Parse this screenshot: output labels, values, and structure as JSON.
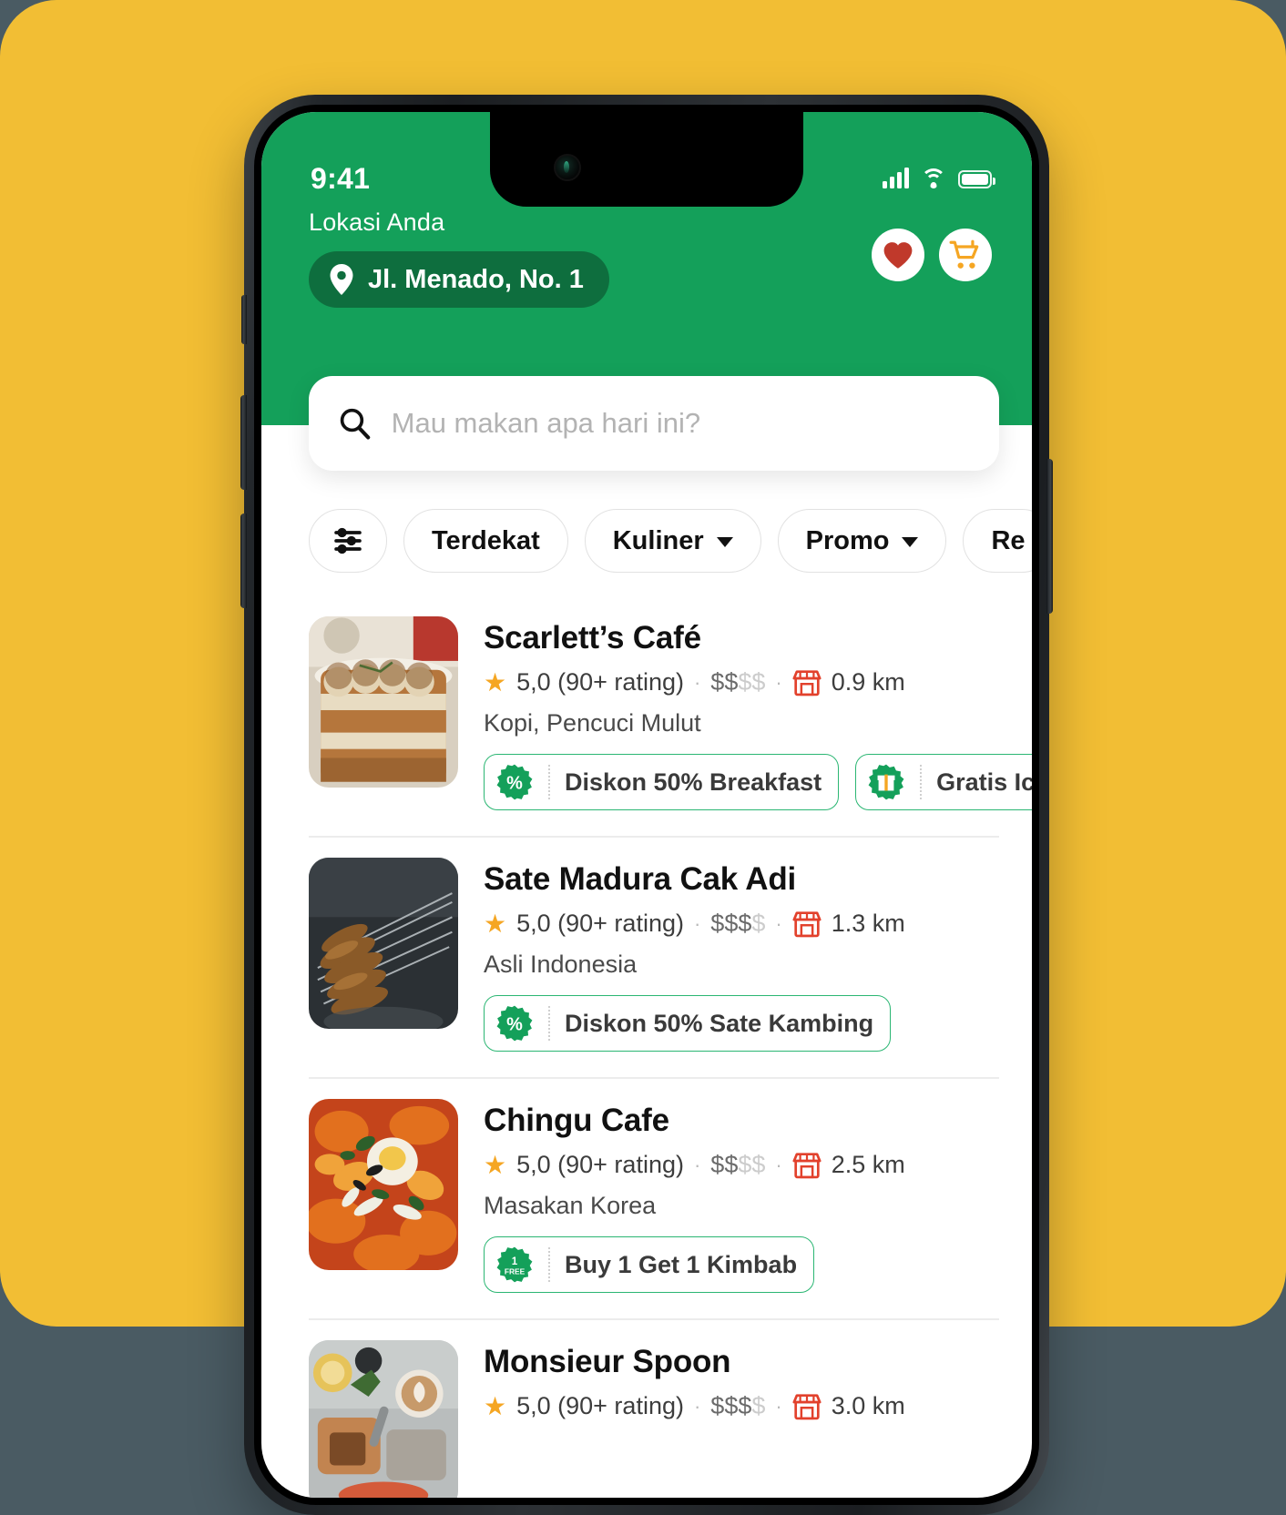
{
  "theme": {
    "backdrop_yellow": "#F2BE34",
    "brand_green": "#14A05A",
    "pill_green": "#0E6E3E",
    "promo_green": "#2BB673",
    "star_orange": "#F5A623",
    "store_red": "#E2412C",
    "heart_red": "#C0392B",
    "cart_orange": "#F5A623"
  },
  "status_bar": {
    "time": "9:41",
    "signal": "cellular-bars-icon",
    "wifi": "wifi-icon",
    "battery": "battery-icon"
  },
  "header": {
    "location_label": "Lokasi Anda",
    "location_value": "Jl. Menado, No. 1",
    "pin_icon": "location-pin-icon",
    "favorites_icon": "heart-icon",
    "cart_icon": "shopping-cart-icon"
  },
  "search": {
    "placeholder": "Mau makan apa hari ini?",
    "value": "",
    "icon": "search-icon"
  },
  "filters": [
    {
      "label": "",
      "icon": "sliders-filter-icon",
      "icon_only": true,
      "chevron": false
    },
    {
      "label": "Terdekat",
      "icon": "",
      "icon_only": false,
      "chevron": false
    },
    {
      "label": "Kuliner",
      "icon": "",
      "icon_only": false,
      "chevron": true
    },
    {
      "label": "Promo",
      "icon": "",
      "icon_only": false,
      "chevron": true
    },
    {
      "label": "Re",
      "icon": "",
      "icon_only": false,
      "chevron": false
    }
  ],
  "restaurants": [
    {
      "name": "Scarlett’s  Café",
      "rating": "5,0 (90+ rating)",
      "price_on": "$$",
      "price_off": "$$",
      "distance": "0.9 km",
      "category": "Kopi, Pencuci Mulut",
      "thumb": "tiramisu-photo",
      "promos": [
        {
          "label": "Diskon 50% Breakfast",
          "icon": "percent-badge-icon"
        },
        {
          "label": "Gratis Ice Cream",
          "icon": "gift-badge-icon"
        }
      ]
    },
    {
      "name": "Sate Madura Cak Adi",
      "rating": "5,0 (90+ rating)",
      "price_on": "$$$",
      "price_off": "$",
      "distance": "1.3 km",
      "category": "Asli Indonesia",
      "thumb": "satay-grill-photo",
      "promos": [
        {
          "label": "Diskon 50% Sate Kambing",
          "icon": "percent-badge-icon"
        }
      ]
    },
    {
      "name": "Chingu Cafe",
      "rating": "5,0 (90+ rating)",
      "price_on": "$$",
      "price_off": "$$",
      "distance": "2.5 km",
      "category": "Masakan Korea",
      "thumb": "korean-stew-photo",
      "promos": [
        {
          "label": "Buy 1 Get 1 Kimbab",
          "icon": "one-free-badge-icon"
        }
      ]
    },
    {
      "name": "Monsieur Spoon",
      "rating": "5,0 (90+ rating)",
      "price_on": "$$$",
      "price_off": "$",
      "distance": "3.0 km",
      "category": "",
      "thumb": "brunch-table-photo",
      "promos": []
    }
  ],
  "icons": {
    "store": "storefront-icon",
    "star": "star-icon"
  }
}
